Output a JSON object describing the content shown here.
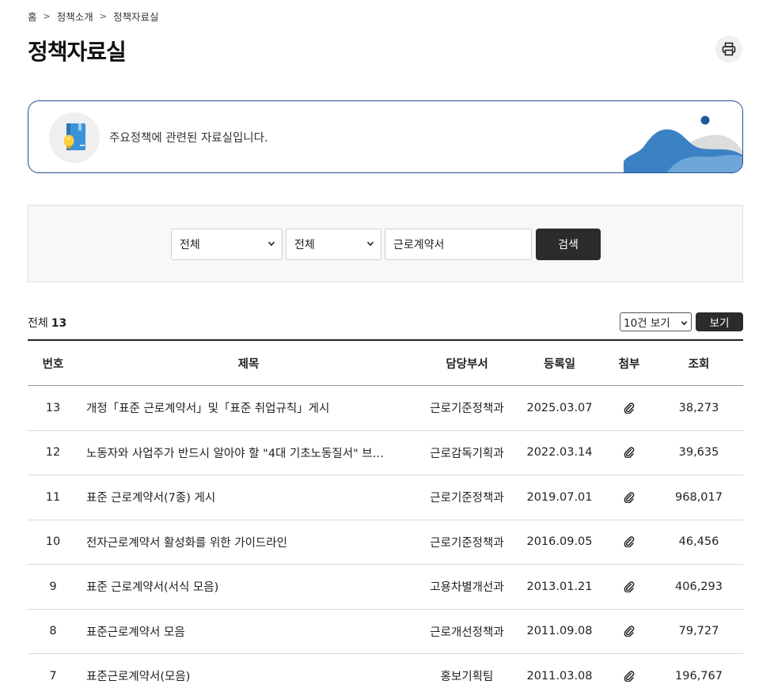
{
  "breadcrumb": [
    "홈",
    "정책소개",
    "정책자료실"
  ],
  "page_title": "정책자료실",
  "print_icon": "printer-icon",
  "intro": {
    "text": "주요정책에 관련된 자료실입니다.",
    "icon": "book-lightbulb-icon"
  },
  "search": {
    "select1_value": "전체",
    "select2_value": "전체",
    "keyword": "근로계약서",
    "button_label": "검색"
  },
  "total": {
    "label": "전체",
    "count": "13"
  },
  "page_size": {
    "value": "10건 보기",
    "button_label": "보기"
  },
  "table": {
    "headers": {
      "no": "번호",
      "title": "제목",
      "dept": "담당부서",
      "date": "등록일",
      "attach": "첨부",
      "views": "조회"
    },
    "rows": [
      {
        "no": "13",
        "title": "개정「표준 근로계약서」및「표준 취업규칙」게시",
        "dept": "근로기준정책과",
        "date": "2025.03.07",
        "views": "38,273"
      },
      {
        "no": "12",
        "title": "노동자와 사업주가 반드시 알아야 할 \"4대 기초노동질서\" 브…",
        "dept": "근로감독기획과",
        "date": "2022.03.14",
        "views": "39,635"
      },
      {
        "no": "11",
        "title": "표준 근로계약서(7종) 게시",
        "dept": "근로기준정책과",
        "date": "2019.07.01",
        "views": "968,017"
      },
      {
        "no": "10",
        "title": "전자근로계약서 활성화를 위한 가이드라인",
        "dept": "근로기준정책과",
        "date": "2016.09.05",
        "views": "46,456"
      },
      {
        "no": "9",
        "title": "표준 근로계약서(서식 모음)",
        "dept": "고용차별개선과",
        "date": "2013.01.21",
        "views": "406,293"
      },
      {
        "no": "8",
        "title": "표준근로계약서 모음",
        "dept": "근로개선정책과",
        "date": "2011.09.08",
        "views": "79,727"
      },
      {
        "no": "7",
        "title": "표준근로계약서(모음)",
        "dept": "홍보기획팀",
        "date": "2011.03.08",
        "views": "196,767"
      }
    ]
  }
}
